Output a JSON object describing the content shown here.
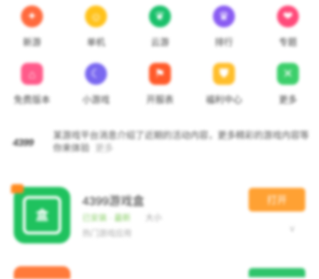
{
  "categories_row1": [
    {
      "label": "新游",
      "icon": "flame-icon",
      "color": "#ff6a3d",
      "glyph": "✦"
    },
    {
      "label": "单机",
      "icon": "smile-icon",
      "color": "#ffc21a",
      "glyph": "☺"
    },
    {
      "label": "云游",
      "icon": "leaf-icon",
      "color": "#19c06a",
      "glyph": "❦"
    },
    {
      "label": "排行",
      "icon": "crown-icon",
      "color": "#8a5cf2",
      "glyph": "♛"
    },
    {
      "label": "专题",
      "icon": "heart-icon",
      "color": "#ff4a7a",
      "glyph": "❤"
    }
  ],
  "categories_row2": [
    {
      "label": "免费版本",
      "icon": "gift-icon",
      "color": "#ff5a8a",
      "glyph": "⌂"
    },
    {
      "label": "小游戏",
      "icon": "moon-icon",
      "color": "#7a68f0",
      "glyph": "☾"
    },
    {
      "label": "开服表",
      "icon": "flag-icon",
      "color": "#ff5a2a",
      "glyph": "⚑"
    },
    {
      "label": "福利中心",
      "icon": "shield-icon",
      "color": "#ffbe2a",
      "glyph": "⛊"
    },
    {
      "label": "更多",
      "icon": "grid-icon",
      "color": "#3ccf6b",
      "glyph": "✕"
    }
  ],
  "ticker": {
    "tag": "4399",
    "text": "某游戏平台消息介绍了近期的活动内容，更多精彩的游戏内容等你来体验",
    "more": "更多"
  },
  "app": {
    "name": "4399游戏盒",
    "icon_glyph": "盒",
    "meta": "已安装 · 最新",
    "size": "大小",
    "desc": "热门游戏应用",
    "open_label": "打开",
    "chevron": "∨"
  }
}
